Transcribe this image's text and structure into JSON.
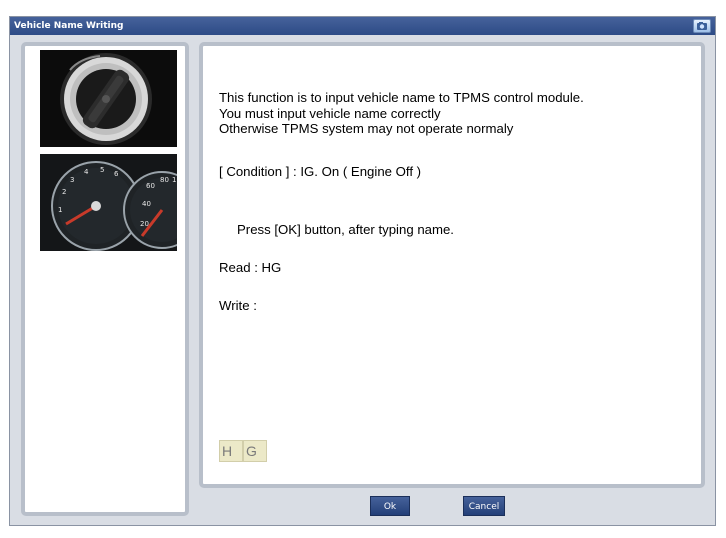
{
  "window": {
    "title": "Vehicle Name Writing"
  },
  "message": {
    "line1": "This function is to input vehicle name to TPMS control module.",
    "line2": "You must input vehicle name correctly",
    "line3": "Otherwise  TPMS system may not operate normaly",
    "condition": "[ Condition ] : IG. On ( Engine Off )",
    "instruction": "Press [OK] button, after typing name.",
    "read": "Read : HG",
    "write": "Write :"
  },
  "name_input": {
    "chars": [
      "H",
      "G"
    ]
  },
  "buttons": {
    "ok": "Ok",
    "cancel": "Cancel"
  },
  "colors": {
    "title_bar": "#2d4b86",
    "panel_border": "#b8bfca",
    "input_cell": "#ece9c8"
  },
  "icons": {
    "title_icon": "camera-icon"
  }
}
